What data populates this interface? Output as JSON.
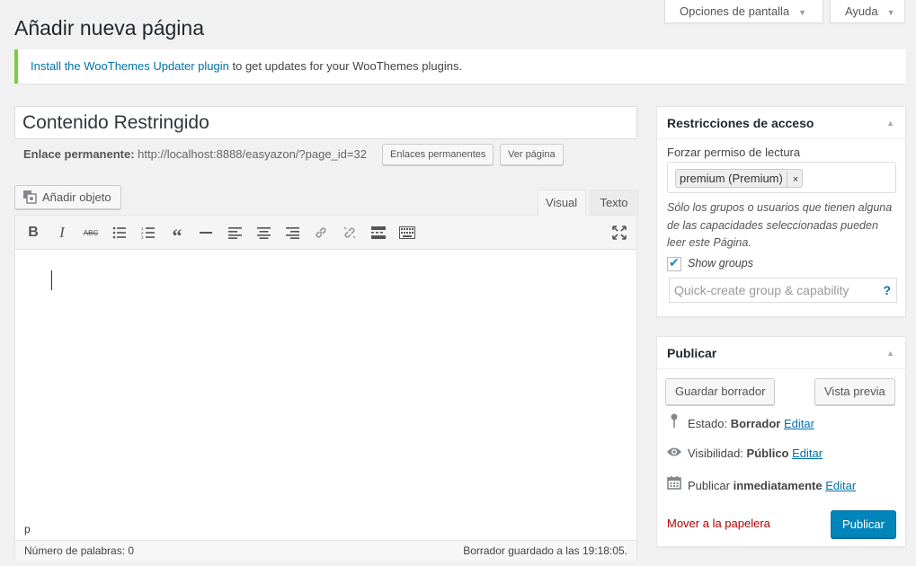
{
  "screen_options": {
    "label": "Opciones de pantalla",
    "caret": "▼"
  },
  "help": {
    "label": "Ayuda",
    "caret": "▼"
  },
  "page_title": "Añadir nueva página",
  "notice": {
    "link": "Install the WooThemes Updater plugin",
    "rest": " to get updates for your WooThemes plugins."
  },
  "post_title": "Contenido Restringido",
  "permalink": {
    "label": "Enlace permanente:",
    "url": "http://localhost:8888/easyazon/?page_id=32",
    "permalinks_button": "Enlaces permanentes",
    "view_button": "Ver página"
  },
  "add_media": "Añadir objeto",
  "editor": {
    "tab_visual": "Visual",
    "tab_text": "Texto",
    "toolbar": [
      "bold-icon",
      "italic-icon",
      "strikethrough-icon",
      "bullet-list-icon",
      "numbered-list-icon",
      "blockquote-icon",
      "horizontal-rule-icon",
      "align-left-icon",
      "align-center-icon",
      "align-right-icon",
      "link-icon",
      "unlink-icon",
      "read-more-icon",
      "toolbar-toggle-icon",
      "fullscreen-icon"
    ],
    "path": "p",
    "word_count": "Número de palabras: 0",
    "autosave": "Borrador guardado a las 19:18:05."
  },
  "access": {
    "title": "Restricciones de acceso",
    "label": "Forzar permiso de lectura",
    "chip": "premium (Premium)",
    "chip_remove": "×",
    "description": "Sólo los grupos o usuarios que tienen alguna de las capacidades seleccionadas pueden leer este Página.",
    "show_groups": "Show groups",
    "show_groups_checked": true,
    "quick_create_placeholder": "Quick-create group & capability",
    "quick_help": "?"
  },
  "publish": {
    "title": "Publicar",
    "save_draft": "Guardar borrador",
    "preview": "Vista previa",
    "status_label": "Estado:",
    "status_value": "Borrador",
    "visibility_label": "Visibilidad:",
    "visibility_value": "Público",
    "publish_label": "Publicar",
    "publish_value": "inmediatamente",
    "edit": "Editar",
    "trash": "Mover a la papelera",
    "publish_button": "Publicar"
  },
  "colors": {
    "accent": "#0085ba",
    "notice_border": "#7ad03a",
    "link": "#0073aa",
    "trash": "#aa0000"
  }
}
